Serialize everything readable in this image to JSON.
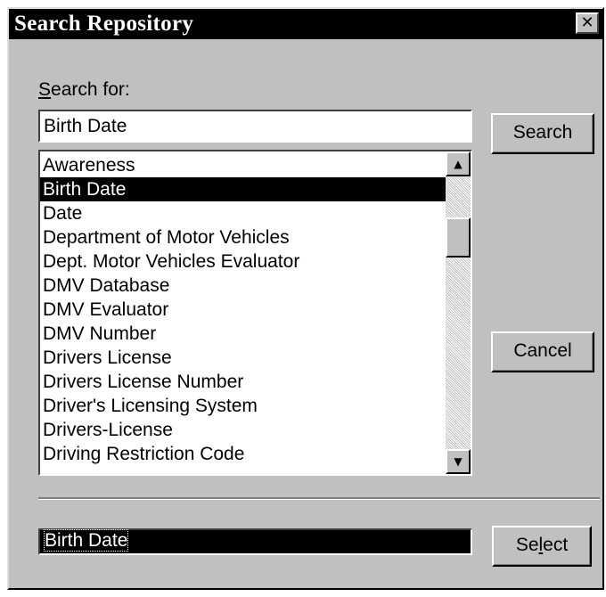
{
  "window": {
    "title": "Search Repository",
    "close_glyph": "✕",
    "colors": {
      "face": "#c0c0c0",
      "titlebar": "#000000",
      "selection": "#000000"
    }
  },
  "search": {
    "label_accel": "S",
    "label_rest": "earch for:",
    "value": "Birth Date",
    "button_label": "Search"
  },
  "results": {
    "items": [
      "Awareness",
      "Birth Date",
      "Date",
      "Department of Motor Vehicles",
      "Dept. Motor Vehicles Evaluator",
      "DMV Database",
      "DMV Evaluator",
      "DMV Number",
      "Drivers License",
      "Drivers License Number",
      "Driver's Licensing System",
      "Drivers-License",
      "Driving Restriction Code"
    ],
    "selected_index": 1,
    "scroll_up_icon": "triangle-up",
    "scroll_down_icon": "triangle-down",
    "scroll_up_glyph": "▲",
    "scroll_down_glyph": "▼"
  },
  "cancel_label": "Cancel",
  "selection": {
    "value": "Birth Date",
    "button_pre": "Se",
    "button_accel": "l",
    "button_post": "ect"
  }
}
